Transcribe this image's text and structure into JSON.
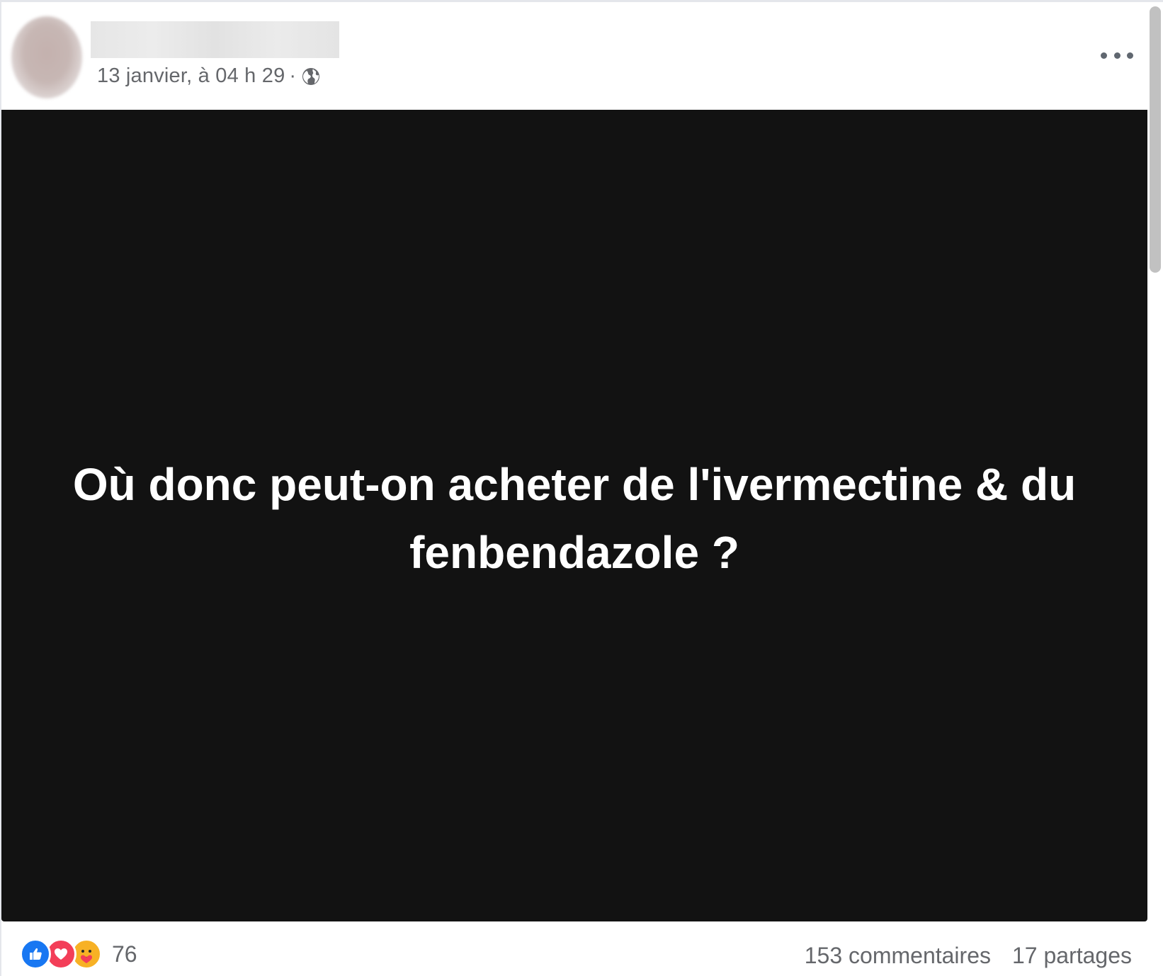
{
  "post": {
    "timestamp": "13 janvier, à 04 h 29",
    "separator": "·",
    "privacy_icon": "globe-icon",
    "more_icon": "more-options-icon",
    "image_text": "Où donc peut-on acheter de l'ivermectine & du fenbendazole ?",
    "image_background": "#121212",
    "image_text_color": "#ffffff"
  },
  "footer": {
    "reaction_icons": [
      "like-icon",
      "love-icon",
      "care-icon"
    ],
    "reaction_count": "76",
    "comments": "153 commentaires",
    "shares": "17 partages"
  }
}
